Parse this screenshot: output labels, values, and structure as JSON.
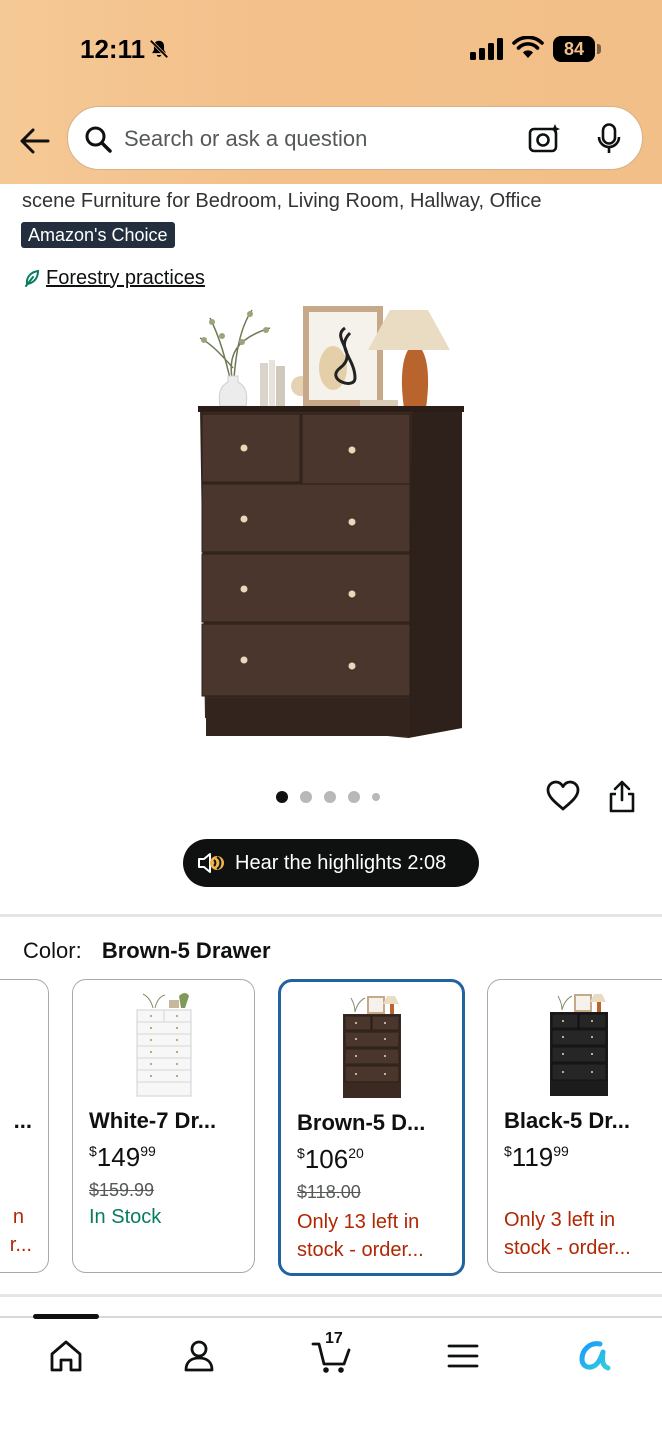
{
  "status_bar": {
    "time": "12:11",
    "battery": "84"
  },
  "search": {
    "placeholder": "Search or ask a question"
  },
  "product": {
    "title_tail": "scene Furniture for Bedroom, Living Room, Hallway, Office",
    "badge": "Amazon's Choice",
    "forestry_link": "Forestry practices",
    "image_count": 5,
    "active_image": 1
  },
  "audio": {
    "label": "Hear the highlights 2:08"
  },
  "color": {
    "label": "Color:",
    "value": "Brown-5 Drawer"
  },
  "variants": [
    {
      "name": "...",
      "stock_line1": "n",
      "stock_line2": "r..."
    },
    {
      "name": "White-7 Dr...",
      "price_currency": "$",
      "price_whole": "149",
      "price_fraction": "99",
      "list_price": "$159.99",
      "stock": "In Stock"
    },
    {
      "name": "Brown-5 D...",
      "price_currency": "$",
      "price_whole": "106",
      "price_fraction": "20",
      "list_price": "$118.00",
      "stock_line1": "Only 13 left in",
      "stock_line2": "stock - order...",
      "selected": true
    },
    {
      "name": "Black-5 Dr...",
      "price_currency": "$",
      "price_whole": "119",
      "price_fraction": "99",
      "stock_line1": "Only 3 left in",
      "stock_line2": "stock - order..."
    }
  ],
  "bottom_nav": {
    "cart_count": "17",
    "items": [
      "home-icon",
      "account-icon",
      "cart-icon",
      "menu-icon",
      "rufus-icon"
    ]
  },
  "colors": {
    "header": "#f3c08b",
    "selected_border": "#2162a1",
    "in_stock": "#067d62",
    "low_stock": "#b12704",
    "badge_bg": "#232f3e"
  }
}
